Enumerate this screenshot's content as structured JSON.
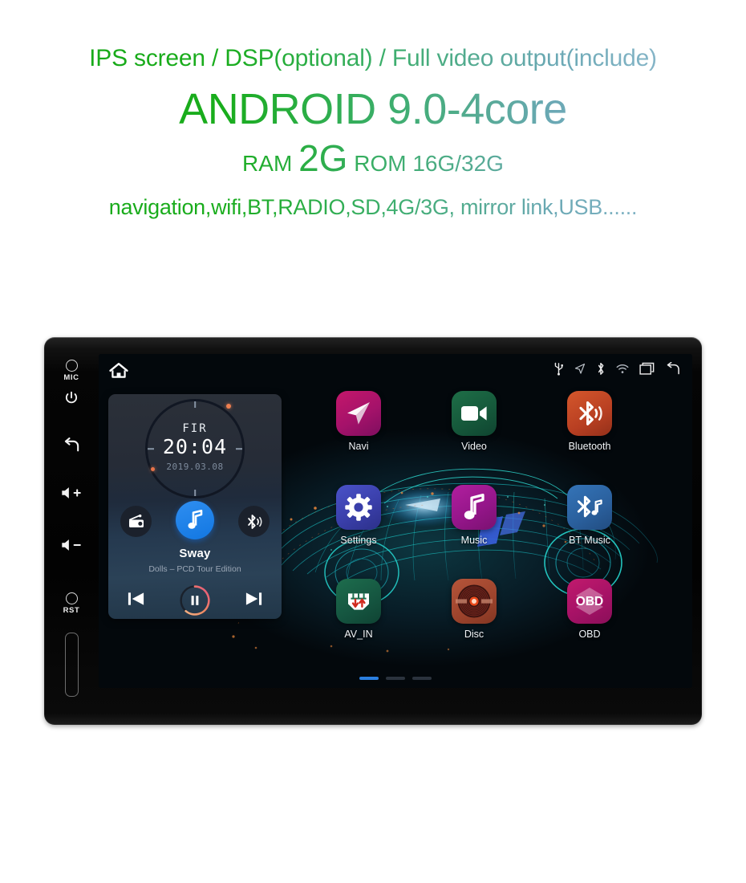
{
  "promo": {
    "line1": "IPS screen / DSP(optional) / Full video output(include)",
    "line2": "ANDROID 9.0-4core",
    "ram_label": "RAM",
    "ram_value": "2G",
    "rom_label": "ROM 16G/32G",
    "features": "navigation,wifi,BT,RADIO,SD,4G/3G, mirror link,USB......",
    "gradient_start": "#18a818",
    "gradient_end": "#9cc0d8"
  },
  "device": {
    "hardware_buttons": [
      {
        "name": "mic",
        "label": "MIC"
      },
      {
        "name": "power",
        "label": ""
      },
      {
        "name": "back",
        "label": ""
      },
      {
        "name": "volume-up",
        "label": ""
      },
      {
        "name": "volume-down",
        "label": ""
      },
      {
        "name": "reset",
        "label": "RST"
      },
      {
        "name": "card-slot",
        "label": ""
      }
    ],
    "statusbar": {
      "home_icon": "home-icon",
      "icons": [
        "usb-icon",
        "navigation-icon",
        "bluetooth-icon",
        "wifi-icon",
        "recents-icon",
        "back-icon"
      ]
    },
    "widget": {
      "clock_title": "FIR",
      "clock_time": "20:04",
      "clock_date": "2019.03.08",
      "sources": [
        {
          "name": "radio",
          "icon": "radio-icon"
        },
        {
          "name": "music",
          "icon": "music-note-icon",
          "active": true
        },
        {
          "name": "bluetooth",
          "icon": "bluetooth-audio-icon"
        }
      ],
      "track_title": "Sway",
      "track_subtitle": "Dolls – PCD Tour Edition",
      "controls": [
        {
          "name": "previous",
          "icon": "skip-previous-icon"
        },
        {
          "name": "play-pause",
          "icon": "pause-icon"
        },
        {
          "name": "next",
          "icon": "skip-next-icon"
        }
      ],
      "accent_color": "#1277e2",
      "progress_color": "#f08a5d"
    },
    "apps": [
      {
        "label": "Navi",
        "icon": "paper-plane-icon",
        "color": "#c4176b"
      },
      {
        "label": "Video",
        "icon": "video-camera-icon",
        "color": "#1e6e47"
      },
      {
        "label": "Bluetooth",
        "icon": "bluetooth-icon",
        "color": "#d4572c"
      },
      {
        "label": "Settings",
        "icon": "gear-icon",
        "color": "#4a52c8"
      },
      {
        "label": "Music",
        "icon": "music-note-icon",
        "color": "#b11f9e"
      },
      {
        "label": "BT Music",
        "icon": "bluetooth-music-icon",
        "color": "#3474b8"
      },
      {
        "label": "AV_IN",
        "icon": "av-input-icon",
        "color": "#1d6d4d"
      },
      {
        "label": "Disc",
        "icon": "disc-icon",
        "color": "#b5553a"
      },
      {
        "label": "OBD",
        "icon": "obd-icon",
        "color": "#c11a6d"
      }
    ],
    "pagination": {
      "total": 3,
      "active": 1
    }
  }
}
